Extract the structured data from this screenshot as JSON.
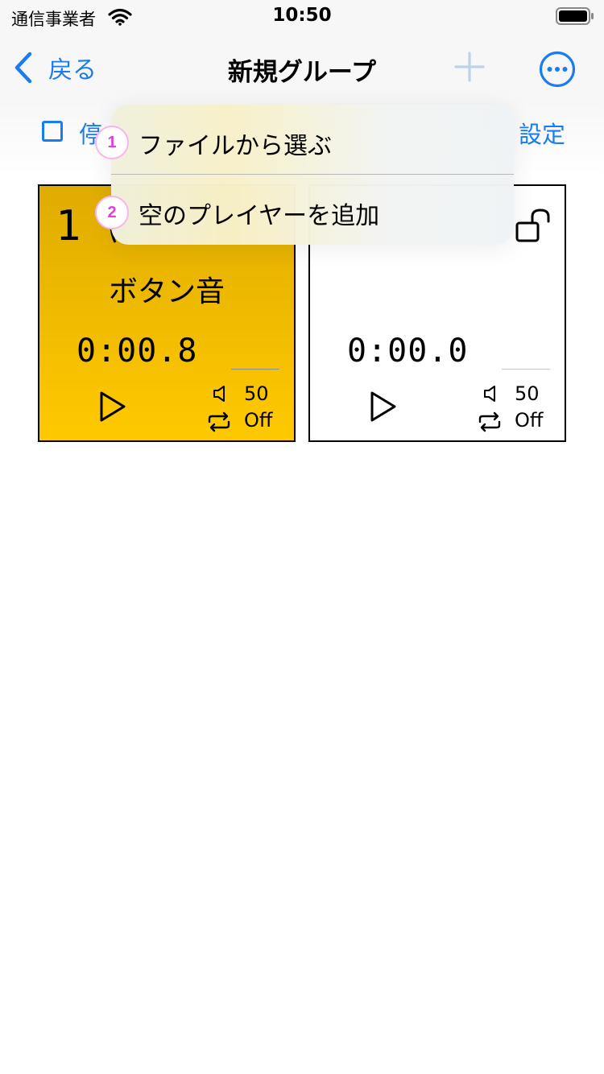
{
  "status_bar": {
    "carrier": "通信事業者",
    "time": "10:50"
  },
  "nav": {
    "back_label": "戻る",
    "title": "新規グループ"
  },
  "toolbar": {
    "stop_label": "停",
    "settings_label": "設定"
  },
  "players": [
    {
      "number": "1",
      "title": "ボタン音",
      "time": "0:00.8",
      "volume": "50",
      "repeat": "Off",
      "color": "#ffc900"
    },
    {
      "number": "",
      "title": "",
      "time": "0:00.0",
      "volume": "50",
      "repeat": "Off",
      "color": "#ffffff"
    }
  ],
  "menu": {
    "items": [
      {
        "badge": "1",
        "label": "ファイルから選ぶ"
      },
      {
        "badge": "2",
        "label": "空のプレイヤーを追加"
      }
    ]
  },
  "colors": {
    "accent": "#1a7cf0",
    "badge": "#e040d8"
  },
  "icons": [
    "wifi-icon",
    "battery-icon",
    "back-chevron-icon",
    "add-icon",
    "more-icon",
    "lock-open-icon",
    "play-icon",
    "volume-icon",
    "repeat-icon"
  ]
}
